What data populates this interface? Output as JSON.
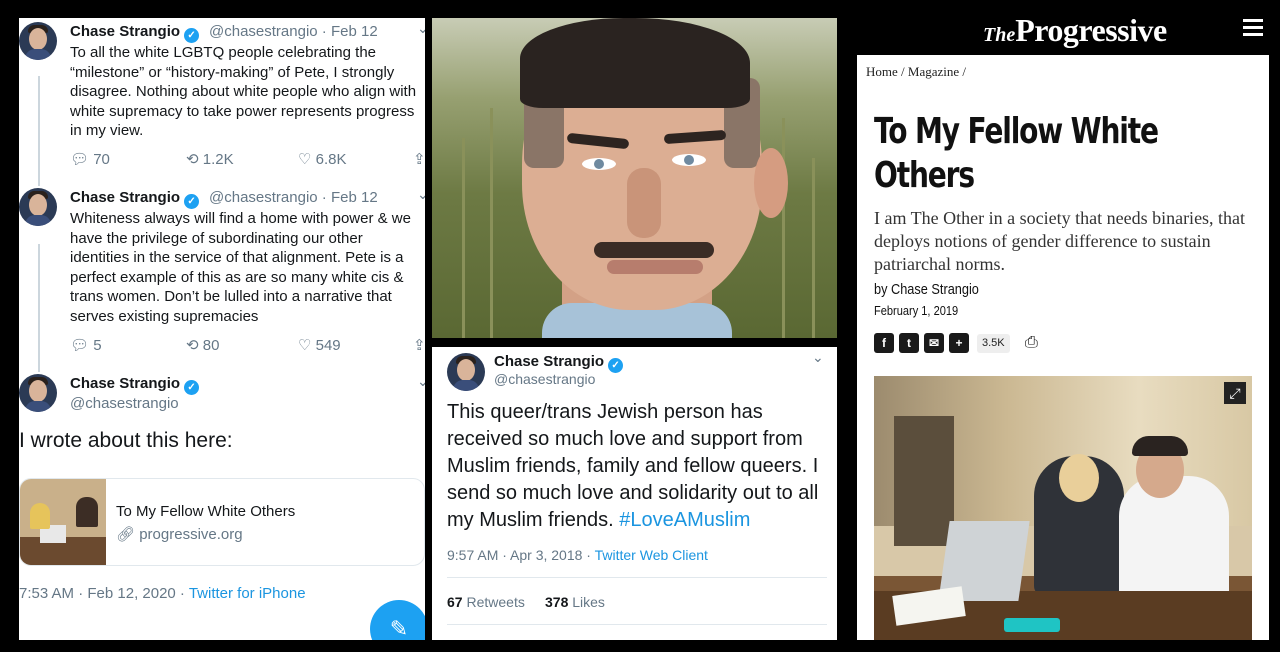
{
  "left_thread": {
    "tweet1": {
      "name": "Chase Strangio",
      "handle": "@chasestrangio",
      "date": "· Feb 12",
      "text": "To all the white LGBTQ people celebrating the “milestone” or “history-making” of Pete, I strongly disagree. Nothing about white people who align with white supremacy to take power represents progress in my view.",
      "replies": "70",
      "retweets": "1.2K",
      "likes": "6.8K"
    },
    "tweet2": {
      "name": "Chase Strangio",
      "handle": "@chasestrangio",
      "date": "· Feb 12",
      "text": "Whiteness always will find a home with power & we have the privilege of subordinating our other identities in the service of that alignment. Pete is a perfect example of this as are so many white cis & trans women. Don’t be lulled into a narrative that serves existing supremacies",
      "replies": "5",
      "retweets": "80",
      "likes": "549"
    },
    "tweet3": {
      "name": "Chase Strangio",
      "handle": "@chasestrangio",
      "text": "I wrote about this here:",
      "card_title": "To My Fellow White Others",
      "card_link": "progressive.org",
      "time": "7:53 AM · Feb 12, 2020 · ",
      "source": "Twitter for iPhone"
    }
  },
  "mid_tweet": {
    "name": "Chase Strangio",
    "handle": "@chasestrangio",
    "text": "This queer/trans Jewish person has received so much love and support from Muslim friends, family and fellow queers. I send so much love and solidarity out to all my Muslim friends. ",
    "hashtag": "#LoveAMuslim",
    "time": "9:57 AM · Apr 3, 2018 · ",
    "source": "Twitter Web Client",
    "retweets_count": "67",
    "retweets_label": "Retweets",
    "likes_count": "378",
    "likes_label": "Likes"
  },
  "article": {
    "masthead_the": "The",
    "masthead_name": "Progressive",
    "breadcrumb": "Home / Magazine /",
    "title": "To My Fellow White Others",
    "dek": "I am The Other in a society that needs binaries, that deploys notions of gender difference to sustain patriarchal norms.",
    "byline": "by Chase Strangio",
    "date": "February 1, 2019",
    "share_count": "3.5K"
  },
  "icons": {
    "verified": "verified-badge-icon",
    "reply": "reply-icon",
    "retweet": "retweet-icon",
    "like": "heart-icon",
    "share": "share-icon",
    "link": "link-icon",
    "compose": "compose-icon",
    "menu": "hamburger-menu-icon",
    "print": "print-icon",
    "expand": "expand-icon"
  },
  "colors": {
    "twitter_blue": "#1da1f2",
    "link_blue": "#1b95e0",
    "muted": "#657786"
  }
}
